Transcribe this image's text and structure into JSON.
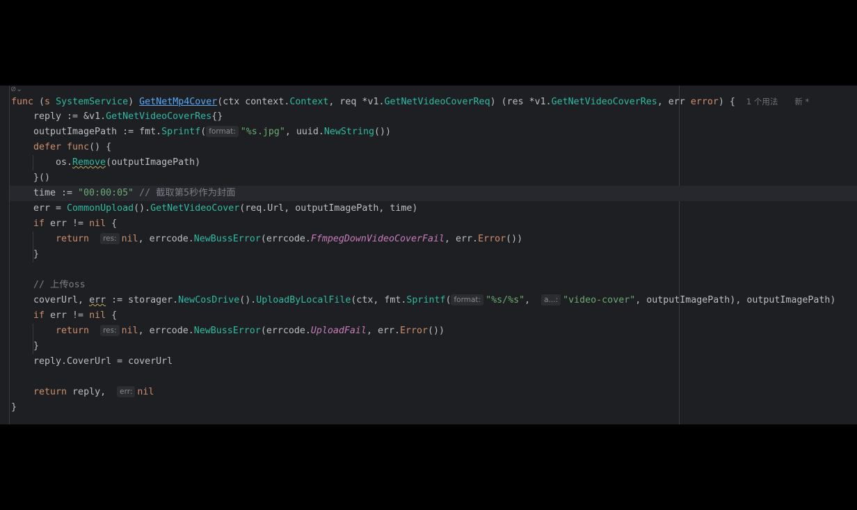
{
  "editor": {
    "fold_icon": "fold-chevron-icon",
    "lines": {
      "l1": {
        "func": "func",
        "recv_open": " (",
        "recv_name": "s",
        "recv_type": "SystemService",
        "recv_close": ") ",
        "name": "GetNetMp4Cover",
        "params_a": "(ctx ",
        "ctx_pkg": "context",
        "dot1": ".",
        "ctx_type": "Context",
        "params_b": ", req *",
        "req_pkg": "v1",
        "dot2": ".",
        "req_type": "GetNetVideoCoverReq",
        "params_c": ") (res *",
        "res_pkg": "v1",
        "dot3": ".",
        "res_type": "GetNetVideoCoverRes",
        "params_d": ", err ",
        "err_type": "error",
        "params_e": ") {",
        "usage_hint": "1 个用法",
        "author_hint": "新 *"
      },
      "l2": {
        "a": "reply := &",
        "pkg": "v1",
        "dot": ".",
        "type": "GetNetVideoCoverRes",
        "b": "{}"
      },
      "l3": {
        "a": "outputImagePath := ",
        "pkg": "fmt",
        "dot": ".",
        "fn": "Sprintf",
        "open": "(",
        "hint": "format:",
        "str": "\"%s.jpg\"",
        "b": ", ",
        "pkg2": "uuid",
        "dot2": ".",
        "fn2": "NewString",
        "c": "())"
      },
      "l4": {
        "defer": "defer",
        "sp": " ",
        "func": "func",
        "b": "() {"
      },
      "l5": {
        "pkg": "os",
        "dot": ".",
        "fn": "Remove",
        "b": "(outputImagePath)"
      },
      "l6": {
        "a": "}()"
      },
      "l7": {
        "a": "time := ",
        "str": "\"00:00:05\"",
        "comment": " // 截取第5秒作为封面"
      },
      "l8": {
        "a": "err = ",
        "fn": "CommonUpload",
        "b": "().",
        "fn2": "GetNetVideoCover",
        "c": "(req.Url, outputImagePath, time)"
      },
      "l9": {
        "if": "if",
        "a": " err != ",
        "nil": "nil",
        "b": " {"
      },
      "l10": {
        "ret": "return",
        "sp": " ",
        "hint": "res:",
        "nil": "nil",
        "a": ", errcode.",
        "fn": "NewBussError",
        "b": "(errcode.",
        "const": "FfmpegDownVideoCoverFail",
        "c": ", err.",
        "fn2": "Error",
        "d": "())"
      },
      "l11": {
        "a": "}"
      },
      "l13": {
        "comment": "// 上传oss"
      },
      "l14": {
        "a": "coverUrl, ",
        "err": "err",
        "b": " := storager.",
        "fn": "NewCosDrive",
        "c": "().",
        "fn2": "UploadByLocalFile",
        "d": "(ctx, fmt.",
        "fn3": "Sprintf",
        "e": "(",
        "hint": "format:",
        "str": "\"%s/%s\"",
        "f": ", ",
        "hint2": "a...:",
        "str2": "\"video-cover\"",
        "g": ", outputImagePath), outputImagePath)"
      },
      "l15": {
        "if": "if",
        "a": " err != ",
        "nil": "nil",
        "b": " {"
      },
      "l16": {
        "ret": "return",
        "sp": " ",
        "hint": "res:",
        "nil": "nil",
        "a": ", errcode.",
        "fn": "NewBussError",
        "b": "(errcode.",
        "const": "UploadFail",
        "c": ", err.",
        "fn2": "Error",
        "d": "())"
      },
      "l17": {
        "a": "}"
      },
      "l18": {
        "a": "reply.CoverUrl = coverUrl"
      },
      "l20": {
        "ret": "return",
        "a": " reply, ",
        "hint": "err:",
        "nil": "nil"
      },
      "l21": {
        "a": "}"
      }
    }
  }
}
